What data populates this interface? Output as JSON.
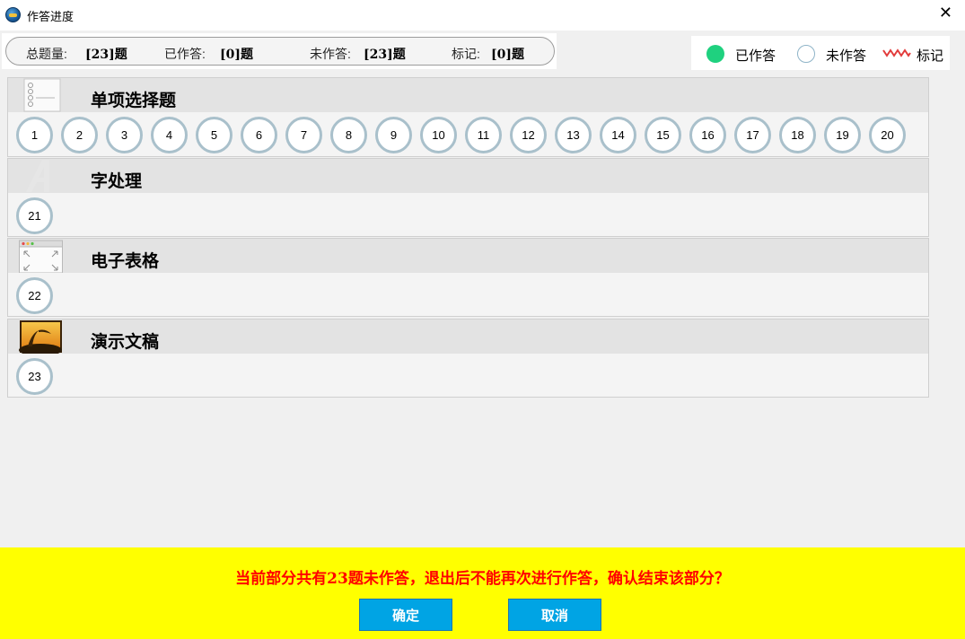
{
  "window": {
    "title": "作答进度",
    "close_symbol": "✕"
  },
  "summary": {
    "total_label": "总题量:",
    "total_value": "[23]题",
    "answered_label": "已作答:",
    "answered_value": "[0]题",
    "unanswered_label": "未作答:",
    "unanswered_value": "[23]题",
    "marked_label": "标记:",
    "marked_value": "[0]题"
  },
  "legend": {
    "answered": "已作答",
    "unanswered": "未作答",
    "marked": "标记",
    "answered_color": "#1fd17f",
    "marked_color": "#e23b3b"
  },
  "sections": [
    {
      "title": "单项选择题",
      "icon": "list-document-icon",
      "questions": [
        "1",
        "2",
        "3",
        "4",
        "5",
        "6",
        "7",
        "8",
        "9",
        "10",
        "11",
        "12",
        "13",
        "14",
        "15",
        "16",
        "17",
        "18",
        "19",
        "20"
      ]
    },
    {
      "title": "字处理",
      "icon": "letter-a-icon",
      "questions": [
        "21"
      ]
    },
    {
      "title": "电子表格",
      "icon": "window-expand-icon",
      "questions": [
        "22"
      ]
    },
    {
      "title": "演示文稿",
      "icon": "sunset-picture-icon",
      "questions": [
        "23"
      ]
    }
  ],
  "confirm": {
    "message": "当前部分共有23题未作答，退出后不能再次进行作答，确认结束该部分？",
    "ok_label": "确定",
    "cancel_label": "取消",
    "background_color": "#ffff00",
    "message_color": "#ff0000",
    "button_color": "#00a4e4"
  }
}
